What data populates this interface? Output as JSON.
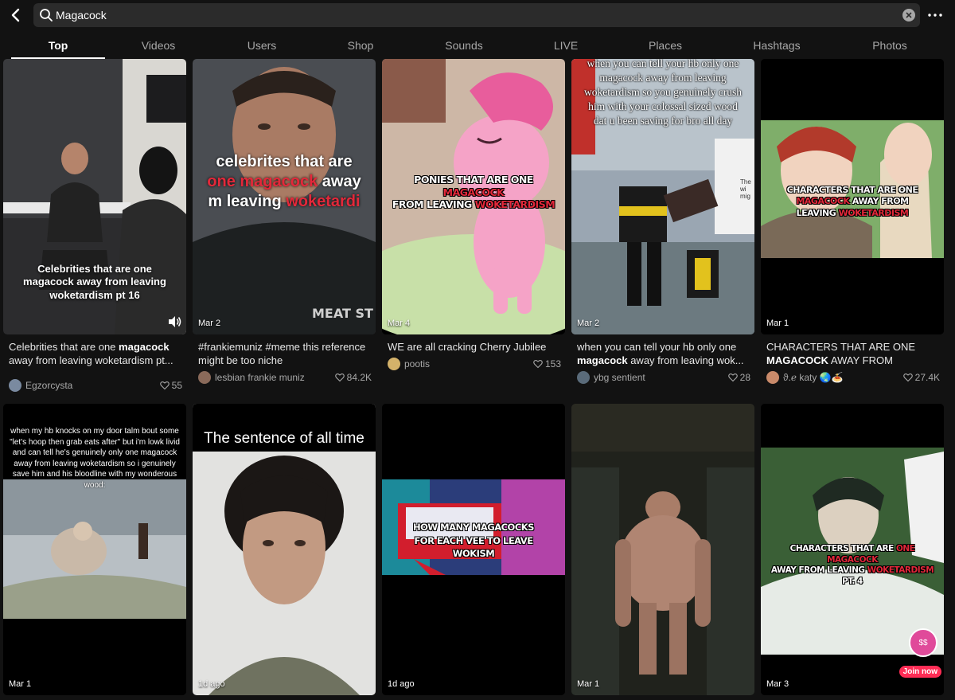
{
  "search": {
    "query": "Magacock"
  },
  "tabs": [
    {
      "label": "Top",
      "active": true
    },
    {
      "label": "Videos"
    },
    {
      "label": "Users"
    },
    {
      "label": "Shop"
    },
    {
      "label": "Sounds"
    },
    {
      "label": "LIVE"
    },
    {
      "label": "Places"
    },
    {
      "label": "Hashtags"
    },
    {
      "label": "Photos"
    }
  ],
  "colors": {
    "background": "#121212",
    "accent": "#fe2c55",
    "overlay_red": "#e3283a"
  },
  "row1": [
    {
      "overlay": "Celebrities that are one magacock away from leaving woketardism pt 16",
      "date": "",
      "caption_pre": "Celebrities that are one ",
      "caption_bold": "magacock",
      "caption_post": " away from leaving woketardism pt...",
      "author": "Egzorcysta",
      "likes": "55",
      "icon": "speaker-icon"
    },
    {
      "overlay_line1": "celebrites that are",
      "overlay_line2a": "one magacock",
      "overlay_line2b": " away",
      "overlay_line3a": "m leaving ",
      "overlay_line3b": "woketardi",
      "shirt_text": "MEAT ST",
      "date": "Mar 2",
      "caption_pre": "#frankiemuniz #meme this reference might be too niche",
      "caption_bold": "",
      "caption_post": "",
      "author": "lesbian frankie muniz",
      "likes": "84.2K"
    },
    {
      "overlay_a": "PONIES THAT ARE ONE ",
      "overlay_b": "MAGACOCK",
      "overlay_c": "FROM LEAVING ",
      "overlay_d": "WOKETARDISM",
      "date": "Mar 4",
      "caption_pre": "WE are all cracking Cherry Jubilee",
      "caption_bold": "",
      "caption_post": "",
      "author": "pootis",
      "likes": "153"
    },
    {
      "overlay": "when you can tell your hb only one magacock away from leaving woketardism so you genuinely crush him with your colossal sized wood dat u been saving for bro all day",
      "sign_text": "The wi mig",
      "date": "Mar 2",
      "caption_pre": "when you can tell your hb only one ",
      "caption_bold": "magacock",
      "caption_post": " away from leaving wok...",
      "author": "ybg sentient",
      "likes": "28"
    },
    {
      "overlay_a": "CHARACTERS THAT ARE ONE ",
      "overlay_b": "MAGACOCK",
      "overlay_c": " AWAY FROM LEAVING ",
      "overlay_d": "WOKETARDISM",
      "date": "Mar 1",
      "caption_pre": "CHARACTERS THAT ARE ONE ",
      "caption_bold": "MAGACOCK",
      "caption_post": " AWAY FROM LEAVIN...",
      "author": "ϑ.ℯ katy 🌏🍝",
      "likes": "27.4K"
    }
  ],
  "row2": [
    {
      "overlay": "when my hb knocks on my door talm bout some \"let's hoop then grab eats after\" but i'm lowk livid and can tell he's genuinely only one magacock away from leaving woketardism so i genuinely save him and his bloodline with my wonderous wood:",
      "date": "Mar 1"
    },
    {
      "overlay": "The sentence of all time",
      "date": "1d ago"
    },
    {
      "overlay_a": "HOW MANY MAGACOCKS",
      "overlay_b": "FOR EACH VEE TO LEAVE",
      "overlay_c": "WOKISM",
      "date": "1d ago"
    },
    {
      "date": "Mar 1"
    },
    {
      "overlay_a": "CHARACTERS THAT ARE ",
      "overlay_b": "ONE MAGACOCK",
      "overlay_c": "AWAY FROM LEAVING ",
      "overlay_d": "WOKETARDISM",
      "overlay_e": "PT. 4",
      "live_badge": "$$",
      "join_label": "Join now",
      "date": "Mar 3"
    }
  ]
}
